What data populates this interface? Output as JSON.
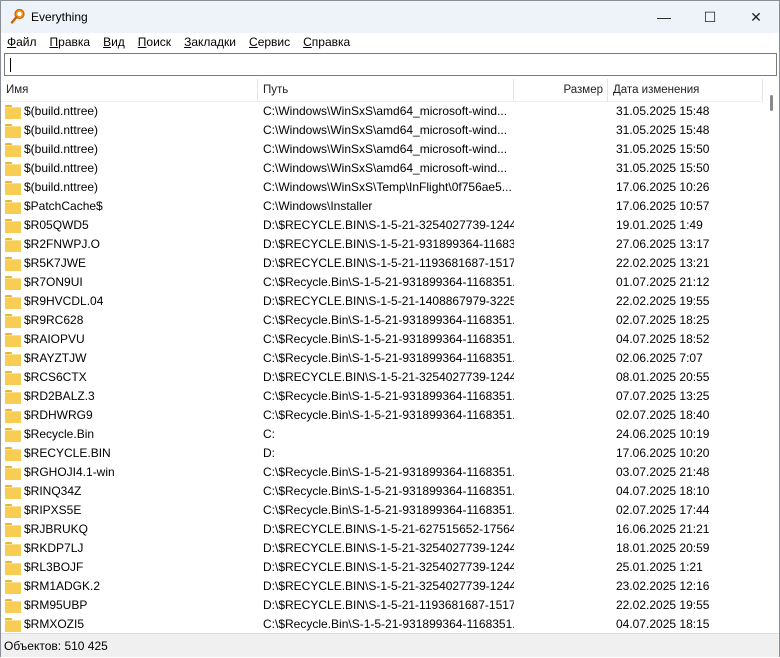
{
  "window": {
    "title": "Everything",
    "minimize": "—",
    "maximize": "☐",
    "close": "✕"
  },
  "menu": [
    {
      "first": "Ф",
      "rest": "айл"
    },
    {
      "first": "П",
      "rest": "равка"
    },
    {
      "first": "В",
      "rest": "ид"
    },
    {
      "first": "П",
      "rest": "оиск"
    },
    {
      "first": "З",
      "rest": "акладки"
    },
    {
      "first": "С",
      "rest": "ервис"
    },
    {
      "first": "С",
      "rest": "правка"
    }
  ],
  "search": {
    "value": ""
  },
  "columns": {
    "name": "Имя",
    "path": "Путь",
    "size": "Размер",
    "date": "Дата изменения"
  },
  "rows": [
    {
      "name": "$(build.nttree)",
      "path": "C:\\Windows\\WinSxS\\amd64_microsoft-wind...",
      "size": "",
      "date": "31.05.2025 15:48"
    },
    {
      "name": "$(build.nttree)",
      "path": "C:\\Windows\\WinSxS\\amd64_microsoft-wind...",
      "size": "",
      "date": "31.05.2025 15:48"
    },
    {
      "name": "$(build.nttree)",
      "path": "C:\\Windows\\WinSxS\\amd64_microsoft-wind...",
      "size": "",
      "date": "31.05.2025 15:50"
    },
    {
      "name": "$(build.nttree)",
      "path": "C:\\Windows\\WinSxS\\amd64_microsoft-wind...",
      "size": "",
      "date": "31.05.2025 15:50"
    },
    {
      "name": "$(build.nttree)",
      "path": "C:\\Windows\\WinSxS\\Temp\\InFlight\\0f756ae5...",
      "size": "",
      "date": "17.06.2025 10:26"
    },
    {
      "name": "$PatchCache$",
      "path": "C:\\Windows\\Installer",
      "size": "",
      "date": "17.06.2025 10:57"
    },
    {
      "name": "$R05QWD5",
      "path": "D:\\$RECYCLE.BIN\\S-1-5-21-3254027739-1244...",
      "size": "",
      "date": "19.01.2025 1:49"
    },
    {
      "name": "$R2FNWPJ.O",
      "path": "D:\\$RECYCLE.BIN\\S-1-5-21-931899364-11683...",
      "size": "",
      "date": "27.06.2025 13:17"
    },
    {
      "name": "$R5K7JWE",
      "path": "D:\\$RECYCLE.BIN\\S-1-5-21-1193681687-1517...",
      "size": "",
      "date": "22.02.2025 13:21"
    },
    {
      "name": "$R7ON9UI",
      "path": "C:\\$Recycle.Bin\\S-1-5-21-931899364-1168351...",
      "size": "",
      "date": "01.07.2025 21:12"
    },
    {
      "name": "$R9HVCDL.04",
      "path": "D:\\$RECYCLE.BIN\\S-1-5-21-1408867979-3225...",
      "size": "",
      "date": "22.02.2025 19:55"
    },
    {
      "name": "$R9RC628",
      "path": "C:\\$Recycle.Bin\\S-1-5-21-931899364-1168351...",
      "size": "",
      "date": "02.07.2025 18:25"
    },
    {
      "name": "$RAIOPVU",
      "path": "C:\\$Recycle.Bin\\S-1-5-21-931899364-1168351...",
      "size": "",
      "date": "04.07.2025 18:52"
    },
    {
      "name": "$RAYZTJW",
      "path": "C:\\$Recycle.Bin\\S-1-5-21-931899364-1168351...",
      "size": "",
      "date": "02.06.2025 7:07"
    },
    {
      "name": "$RCS6CTX",
      "path": "D:\\$RECYCLE.BIN\\S-1-5-21-3254027739-1244...",
      "size": "",
      "date": "08.01.2025 20:55"
    },
    {
      "name": "$RD2BALZ.3",
      "path": "C:\\$Recycle.Bin\\S-1-5-21-931899364-1168351...",
      "size": "",
      "date": "07.07.2025 13:25"
    },
    {
      "name": "$RDHWRG9",
      "path": "C:\\$Recycle.Bin\\S-1-5-21-931899364-1168351...",
      "size": "",
      "date": "02.07.2025 18:40"
    },
    {
      "name": "$Recycle.Bin",
      "path": "C:",
      "size": "",
      "date": "24.06.2025 10:19"
    },
    {
      "name": "$RECYCLE.BIN",
      "path": "D:",
      "size": "",
      "date": "17.06.2025 10:20"
    },
    {
      "name": "$RGHOJI4.1-win",
      "path": "C:\\$Recycle.Bin\\S-1-5-21-931899364-1168351...",
      "size": "",
      "date": "03.07.2025 21:48"
    },
    {
      "name": "$RINQ34Z",
      "path": "C:\\$Recycle.Bin\\S-1-5-21-931899364-1168351...",
      "size": "",
      "date": "04.07.2025 18:10"
    },
    {
      "name": "$RIPXS5E",
      "path": "C:\\$Recycle.Bin\\S-1-5-21-931899364-1168351...",
      "size": "",
      "date": "02.07.2025 17:44"
    },
    {
      "name": "$RJBRUKQ",
      "path": "D:\\$RECYCLE.BIN\\S-1-5-21-627515652-17564...",
      "size": "",
      "date": "16.06.2025 21:21"
    },
    {
      "name": "$RKDP7LJ",
      "path": "D:\\$RECYCLE.BIN\\S-1-5-21-3254027739-1244...",
      "size": "",
      "date": "18.01.2025 20:59"
    },
    {
      "name": "$RL3BOJF",
      "path": "D:\\$RECYCLE.BIN\\S-1-5-21-3254027739-1244...",
      "size": "",
      "date": "25.01.2025 1:21"
    },
    {
      "name": "$RM1ADGK.2",
      "path": "D:\\$RECYCLE.BIN\\S-1-5-21-3254027739-1244...",
      "size": "",
      "date": "23.02.2025 12:16"
    },
    {
      "name": "$RM95UBP",
      "path": "D:\\$RECYCLE.BIN\\S-1-5-21-1193681687-1517...",
      "size": "",
      "date": "22.02.2025 19:55"
    },
    {
      "name": "$RMXOZI5",
      "path": "C:\\$Recycle.Bin\\S-1-5-21-931899364-1168351...",
      "size": "",
      "date": "04.07.2025 18:15"
    }
  ],
  "status": {
    "text": "Объектов: 510 425"
  },
  "colors": {
    "folder": "#f8cd53",
    "titlebar": "#eef3f9"
  }
}
